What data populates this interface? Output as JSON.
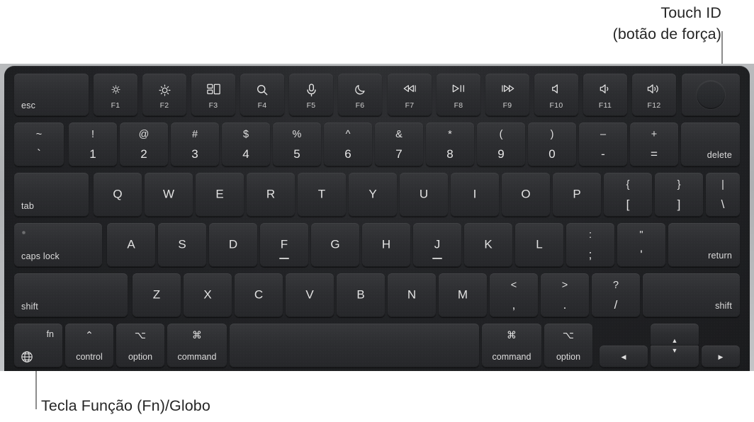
{
  "annotations": {
    "touch_id": {
      "line1": "Touch ID",
      "line2": "(botão de força)"
    },
    "fn_key": {
      "label": "Tecla Função (Fn)/Globo"
    }
  },
  "colors": {
    "body": "#b9bbbd",
    "deck": "#232427",
    "key": "#2e2f32",
    "legend": "#e2e2e2",
    "callout_line": "#8c8c8c",
    "callout_text": "#262626",
    "page_background": "#ffffff"
  },
  "keyboard": {
    "function_row": [
      {
        "name": "esc",
        "label": "esc"
      },
      {
        "name": "f1",
        "fnum": "F1",
        "icon": "brightness-down-icon"
      },
      {
        "name": "f2",
        "fnum": "F2",
        "icon": "brightness-up-icon"
      },
      {
        "name": "f3",
        "fnum": "F3",
        "icon": "mission-control-icon"
      },
      {
        "name": "f4",
        "fnum": "F4",
        "icon": "spotlight-search-icon"
      },
      {
        "name": "f5",
        "fnum": "F5",
        "icon": "dictation-microphone-icon"
      },
      {
        "name": "f6",
        "fnum": "F6",
        "icon": "do-not-disturb-moon-icon"
      },
      {
        "name": "f7",
        "fnum": "F7",
        "icon": "rewind-icon"
      },
      {
        "name": "f8",
        "fnum": "F8",
        "icon": "play-pause-icon"
      },
      {
        "name": "f9",
        "fnum": "F9",
        "icon": "fast-forward-icon"
      },
      {
        "name": "f10",
        "fnum": "F10",
        "icon": "volume-mute-icon"
      },
      {
        "name": "f11",
        "fnum": "F11",
        "icon": "volume-down-icon"
      },
      {
        "name": "f12",
        "fnum": "F12",
        "icon": "volume-up-icon"
      },
      {
        "name": "touch-id",
        "label": "",
        "icon": "touch-id-icon"
      }
    ],
    "number_row": [
      {
        "name": "grave",
        "top": "~",
        "bottom": "`"
      },
      {
        "name": "1",
        "top": "!",
        "bottom": "1"
      },
      {
        "name": "2",
        "top": "@",
        "bottom": "2"
      },
      {
        "name": "3",
        "top": "#",
        "bottom": "3"
      },
      {
        "name": "4",
        "top": "$",
        "bottom": "4"
      },
      {
        "name": "5",
        "top": "%",
        "bottom": "5"
      },
      {
        "name": "6",
        "top": "^",
        "bottom": "6"
      },
      {
        "name": "7",
        "top": "&",
        "bottom": "7"
      },
      {
        "name": "8",
        "top": "*",
        "bottom": "8"
      },
      {
        "name": "9",
        "top": "(",
        "bottom": "9"
      },
      {
        "name": "0",
        "top": ")",
        "bottom": "0"
      },
      {
        "name": "minus",
        "top": "–",
        "bottom": "-"
      },
      {
        "name": "equal",
        "top": "+",
        "bottom": "="
      },
      {
        "name": "delete",
        "label": "delete"
      }
    ],
    "tab_row": [
      {
        "name": "tab",
        "label": "tab"
      },
      {
        "name": "q",
        "letter": "Q"
      },
      {
        "name": "w",
        "letter": "W"
      },
      {
        "name": "e",
        "letter": "E"
      },
      {
        "name": "r",
        "letter": "R"
      },
      {
        "name": "t",
        "letter": "T"
      },
      {
        "name": "y",
        "letter": "Y"
      },
      {
        "name": "u",
        "letter": "U"
      },
      {
        "name": "i",
        "letter": "I"
      },
      {
        "name": "o",
        "letter": "O"
      },
      {
        "name": "p",
        "letter": "P"
      },
      {
        "name": "bracket-left",
        "top": "{",
        "bottom": "["
      },
      {
        "name": "bracket-right",
        "top": "}",
        "bottom": "]"
      },
      {
        "name": "backslash",
        "top": "|",
        "bottom": "\\"
      }
    ],
    "home_row": [
      {
        "name": "caps-lock",
        "label": "caps lock"
      },
      {
        "name": "a",
        "letter": "A"
      },
      {
        "name": "s",
        "letter": "S"
      },
      {
        "name": "d",
        "letter": "D"
      },
      {
        "name": "f",
        "letter": "F",
        "homing": true
      },
      {
        "name": "g",
        "letter": "G"
      },
      {
        "name": "h",
        "letter": "H"
      },
      {
        "name": "j",
        "letter": "J",
        "homing": true
      },
      {
        "name": "k",
        "letter": "K"
      },
      {
        "name": "l",
        "letter": "L"
      },
      {
        "name": "semicolon",
        "top": ":",
        "bottom": ";"
      },
      {
        "name": "quote",
        "top": "\"",
        "bottom": "'"
      },
      {
        "name": "return",
        "label": "return"
      }
    ],
    "shift_row": [
      {
        "name": "shift-left",
        "label": "shift"
      },
      {
        "name": "z",
        "letter": "Z"
      },
      {
        "name": "x",
        "letter": "X"
      },
      {
        "name": "c",
        "letter": "C"
      },
      {
        "name": "v",
        "letter": "V"
      },
      {
        "name": "b",
        "letter": "B"
      },
      {
        "name": "n",
        "letter": "N"
      },
      {
        "name": "m",
        "letter": "M"
      },
      {
        "name": "comma",
        "top": "<",
        "bottom": ","
      },
      {
        "name": "period",
        "top": ">",
        "bottom": "."
      },
      {
        "name": "slash",
        "top": "?",
        "bottom": "/"
      },
      {
        "name": "shift-right",
        "label": "shift"
      }
    ],
    "bottom_row": [
      {
        "name": "fn",
        "label": "fn",
        "icon": "globe-icon"
      },
      {
        "name": "control",
        "sym": "⌃",
        "word": "control"
      },
      {
        "name": "option-left",
        "sym": "⌥",
        "word": "option"
      },
      {
        "name": "command-left",
        "sym": "⌘",
        "word": "command"
      },
      {
        "name": "space",
        "label": ""
      },
      {
        "name": "command-right",
        "sym": "⌘",
        "word": "command"
      },
      {
        "name": "option-right",
        "sym": "⌥",
        "word": "option"
      },
      {
        "name": "arrow-left",
        "icon": "arrow-left-icon"
      },
      {
        "name": "arrow-up",
        "icon": "arrow-up-icon"
      },
      {
        "name": "arrow-down",
        "icon": "arrow-down-icon"
      },
      {
        "name": "arrow-right",
        "icon": "arrow-right-icon"
      }
    ]
  }
}
